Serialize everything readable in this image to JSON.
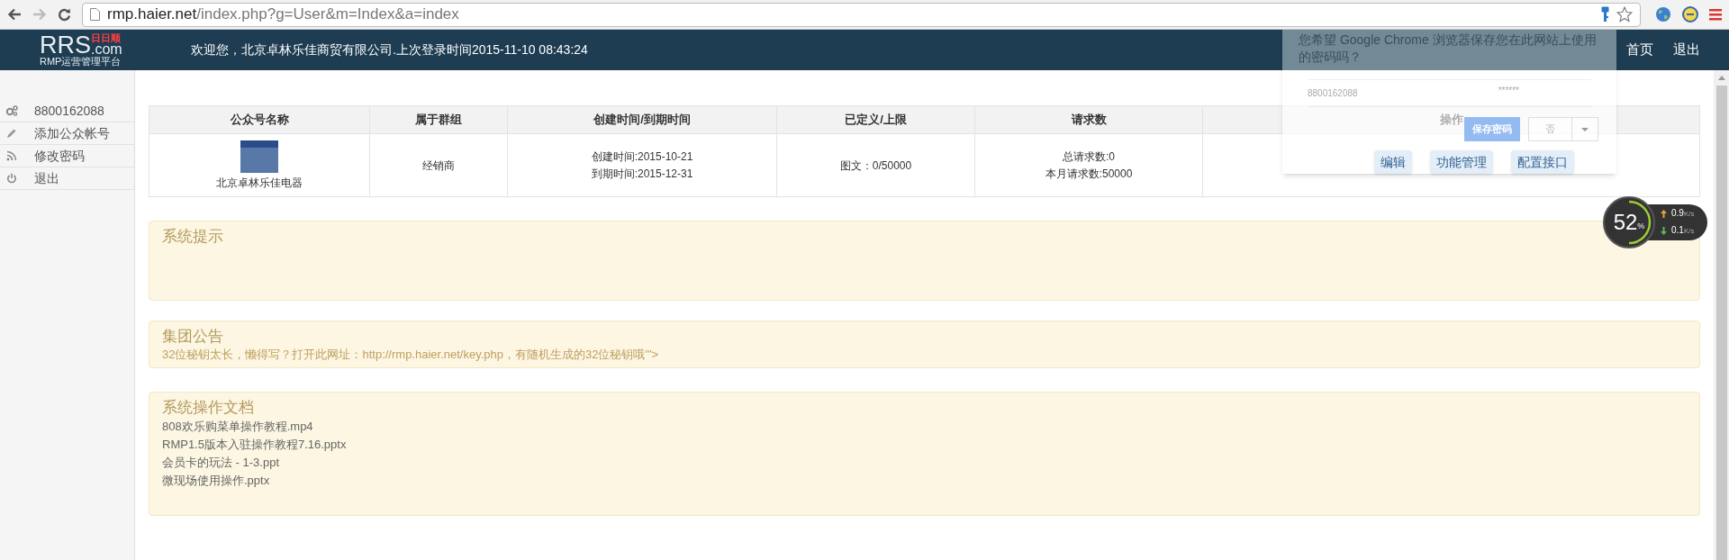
{
  "browser": {
    "url_host": "rmp.haier.net",
    "url_path": "/index.php?g=User&m=Index&a=index"
  },
  "header": {
    "logo_text": "RRS",
    "logo_domain": ".com",
    "logo_badge": "日日顺",
    "logo_subtitle": "RMP运营管理平台",
    "welcome": "欢迎您，北京卓林乐佳商贸有限公司.上次登录时间2015-11-10 08:43:24",
    "nav": [
      "首页",
      "退出"
    ]
  },
  "sidebar": {
    "items": [
      {
        "kind": "gears",
        "label": "8800162088"
      },
      {
        "kind": "pencil",
        "label": "添加公众帐号"
      },
      {
        "kind": "rss",
        "label": "修改密码"
      },
      {
        "kind": "power",
        "label": "退出"
      }
    ]
  },
  "table": {
    "columns": [
      "公众号名称",
      "属于群组",
      "创建时间/到期时间",
      "已定义/上限",
      "请求数",
      "操作"
    ],
    "rows": [
      {
        "name": "北京卓林乐佳电器",
        "group": "经销商",
        "created": "创建时间:2015-10-21",
        "expires": "到期时间:2015-12-31",
        "defined": "图文：0/50000",
        "total_requests": "总请求数:0",
        "month_requests": "本月请求数:50000",
        "actions": [
          "编辑",
          "功能管理",
          "配置接口"
        ]
      }
    ]
  },
  "panels": [
    {
      "title": "系统提示"
    },
    {
      "title": "集团公告",
      "kind": "notice",
      "lines": [
        "32位秘钥太长，懒得写？打开此网址：http://rmp.haier.net/key.php，有随机生成的32位秘钥哦'\">"
      ]
    },
    {
      "title": "系统操作文档",
      "kind": "files",
      "lines": [
        "808欢乐购菜单操作教程.mp4",
        "RMP1.5版本入驻操作教程7.16.pptx",
        "会员卡的玩法 - 1-3.ppt",
        "微现场使用操作.pptx"
      ]
    }
  ],
  "password_prompt": {
    "question": "您希望 Google Chrome 浏览器保存您在此网站上使用的密码吗？",
    "username": "8800162088",
    "password": "******",
    "save_button": "保存密码",
    "never_button": "否"
  },
  "speed_widget": {
    "percent": "52",
    "percent_unit": "%",
    "upload": "0.9",
    "upload_unit": "K/s",
    "download": "0.1",
    "download_unit": "K/s"
  }
}
